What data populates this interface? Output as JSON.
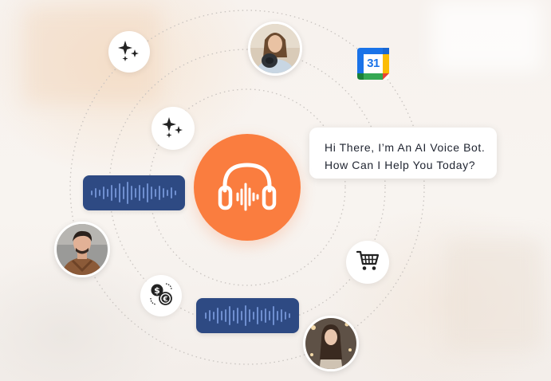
{
  "chat_bubble": {
    "line1": "Hi There, I’m An AI Voice Bot.",
    "line2": "How Can I Help You Today?"
  },
  "calendar": {
    "day": "31"
  },
  "icons": {
    "center": "headphones-waveform-icon",
    "sparkles_top": "sparkles-icon",
    "sparkles_inner": "sparkles-icon",
    "cart": "shopping-cart-icon",
    "currency": "currency-exchange-icon",
    "calendar": "google-calendar-icon"
  },
  "colors": {
    "accent": "#fa7d3f",
    "waveform_pill": "#2e4a83",
    "waveform_bars": "#6f8fd0",
    "ring": "#c9c4c0"
  }
}
